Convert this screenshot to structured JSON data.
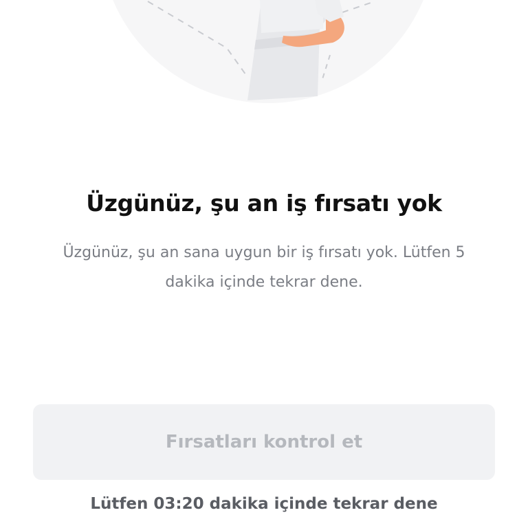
{
  "illustration": {
    "icon": "person-illustration",
    "skin_color": "#f4a77e",
    "shirt_color": "#e8e9ec",
    "circle_color": "#f6f6f7"
  },
  "content": {
    "title": "Üzgünüz, şu an iş fırsatı yok",
    "message": "Üzgünüz, şu an sana uygun bir iş fırsatı yok. Lütfen 5 dakika içinde tekrar dene."
  },
  "actions": {
    "check_button_label": "Fırsatları kontrol et",
    "check_button_disabled": true,
    "retry_hint": "Lütfen 03:20 dakika içinde tekrar dene"
  }
}
